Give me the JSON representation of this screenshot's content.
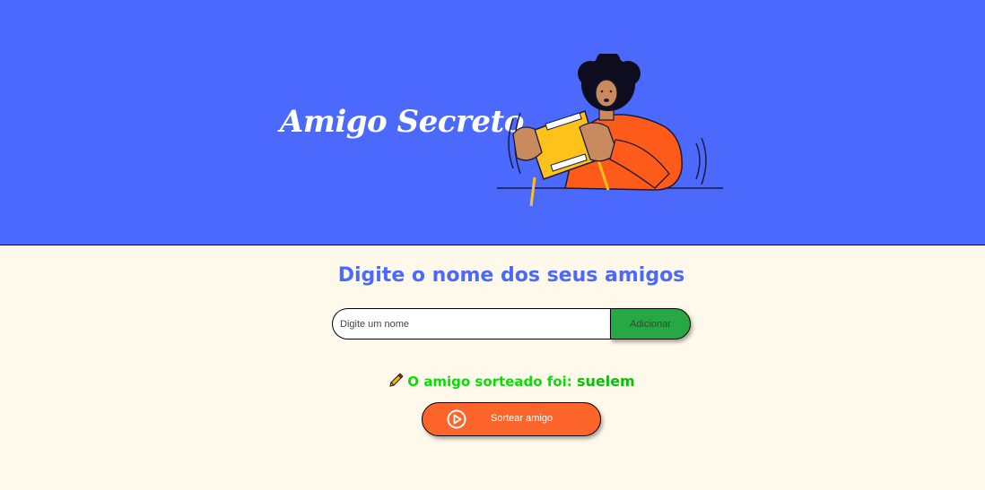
{
  "header": {
    "title": "Amigo Secreto",
    "illustration": "person-playing-handheld-game"
  },
  "main": {
    "section_title": "Digite o nome dos seus amigos",
    "name_input": {
      "placeholder": "Digite um nome",
      "value": ""
    },
    "add_button_label": "Adicionar",
    "result": {
      "icon": "pencil-icon",
      "prefix": "O amigo sorteado foi: ",
      "winner": "suelem"
    },
    "draw_button": {
      "icon": "play-circle-icon",
      "label": "Sortear amigo"
    }
  },
  "colors": {
    "header_bg": "#4b69fd",
    "page_bg": "#fff9eb",
    "title_blue": "#4b69fd",
    "add_button": "#28a745",
    "draw_button": "#fe652b",
    "result_green": "#05df05"
  }
}
